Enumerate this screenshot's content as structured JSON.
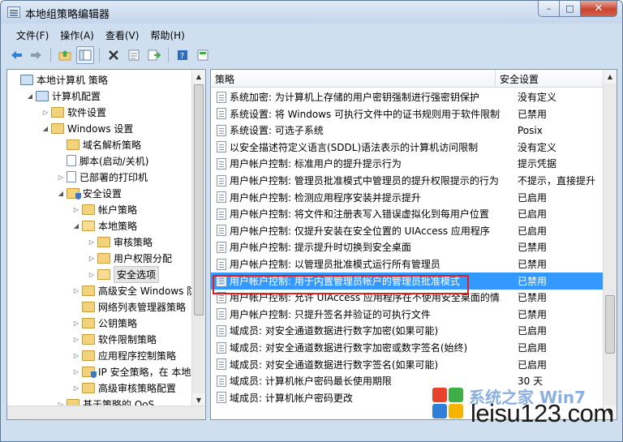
{
  "window": {
    "title": "本地组策略编辑器",
    "min": "–",
    "max": "□",
    "close": "✕"
  },
  "menu": [
    "文件(F)",
    "操作(A)",
    "查看(V)",
    "帮助(H)"
  ],
  "toolbar_icons": [
    "back-arrow-icon",
    "forward-arrow-icon",
    "up-folder-icon",
    "show-tree-icon",
    "delete-icon",
    "properties-icon",
    "export-icon",
    "help-icon",
    "filter-icon"
  ],
  "tree": [
    {
      "label": "本地计算机 策略",
      "indent": 0,
      "arrow": "",
      "icon": "comp"
    },
    {
      "label": "计算机配置",
      "indent": 1,
      "arrow": "◢",
      "icon": "comp"
    },
    {
      "label": "软件设置",
      "indent": 2,
      "arrow": "▷",
      "icon": "folder"
    },
    {
      "label": "Windows 设置",
      "indent": 2,
      "arrow": "◢",
      "icon": "folder"
    },
    {
      "label": "域名解析策略",
      "indent": 3,
      "arrow": "",
      "icon": "folder"
    },
    {
      "label": "脚本(启动/关机)",
      "indent": 3,
      "arrow": "",
      "icon": "doc"
    },
    {
      "label": "已部署的打印机",
      "indent": 3,
      "arrow": "▷",
      "icon": "doc"
    },
    {
      "label": "安全设置",
      "indent": 3,
      "arrow": "◢",
      "icon": "shield"
    },
    {
      "label": "帐户策略",
      "indent": 4,
      "arrow": "▷",
      "icon": "folder"
    },
    {
      "label": "本地策略",
      "indent": 4,
      "arrow": "◢",
      "icon": "open"
    },
    {
      "label": "审核策略",
      "indent": 5,
      "arrow": "▷",
      "icon": "folder"
    },
    {
      "label": "用户权限分配",
      "indent": 5,
      "arrow": "▷",
      "icon": "folder"
    },
    {
      "label": "安全选项",
      "indent": 5,
      "arrow": "▷",
      "icon": "open"
    },
    {
      "label": "高级安全 Windows 防火",
      "indent": 4,
      "arrow": "▷",
      "icon": "folder"
    },
    {
      "label": "网络列表管理器策略",
      "indent": 4,
      "arrow": "",
      "icon": "folder"
    },
    {
      "label": "公钥策略",
      "indent": 4,
      "arrow": "▷",
      "icon": "folder"
    },
    {
      "label": "软件限制策略",
      "indent": 4,
      "arrow": "▷",
      "icon": "folder"
    },
    {
      "label": "应用程序控制策略",
      "indent": 4,
      "arrow": "▷",
      "icon": "folder"
    },
    {
      "label": "IP 安全策略，在 本地计",
      "indent": 4,
      "arrow": "▷",
      "icon": "shield"
    },
    {
      "label": "高级审核策略配置",
      "indent": 4,
      "arrow": "▷",
      "icon": "folder"
    },
    {
      "label": "基于策略的 QoS",
      "indent": 3,
      "arrow": "▷",
      "icon": "folder"
    }
  ],
  "table": {
    "headers": [
      "策略",
      "安全设置"
    ],
    "rows": [
      {
        "policy": "系统加密: 为计算机上存储的用户密钥强制进行强密钥保护",
        "setting": "没有定义"
      },
      {
        "policy": "系统设置: 将 Windows 可执行文件中的证书规则用于软件限制策略",
        "setting": "已禁用"
      },
      {
        "policy": "系统设置: 可选子系统",
        "setting": "Posix"
      },
      {
        "policy": "以安全描述符定义语言(SDDL)语法表示的计算机访问限制",
        "setting": "没有定义"
      },
      {
        "policy": "用户帐户控制: 标准用户的提升提示行为",
        "setting": "提示凭据"
      },
      {
        "policy": "用户帐户控制: 管理员批准模式中管理员的提升权限提示的行为",
        "setting": "不提示，直接提升"
      },
      {
        "policy": "用户帐户控制: 检测应用程序安装并提示提升",
        "setting": "已启用"
      },
      {
        "policy": "用户帐户控制: 将文件和注册表写入错误虚拟化到每用户位置",
        "setting": "已启用"
      },
      {
        "policy": "用户帐户控制: 仅提升安装在安全位置的 UIAccess 应用程序",
        "setting": "已启用"
      },
      {
        "policy": "用户帐户控制: 提示提升时切换到安全桌面",
        "setting": "已禁用"
      },
      {
        "policy": "用户帐户控制: 以管理员批准模式运行所有管理员",
        "setting": "已禁用"
      },
      {
        "policy": "用户帐户控制: 用于内置管理员帐户的管理员批准模式",
        "setting": "已禁用",
        "selected": true
      },
      {
        "policy": "用户帐户控制: 允许 UIAccess 应用程序在不使用安全桌面的情况下提升",
        "setting": "已禁用"
      },
      {
        "policy": "用户帐户控制: 只提升签名并验证的可执行文件",
        "setting": "已禁用"
      },
      {
        "policy": "域成员: 对安全通道数据进行数字加密(如果可能)",
        "setting": "已启用"
      },
      {
        "policy": "域成员: 对安全通道数据进行数字加密或数字签名(始终)",
        "setting": "已启用"
      },
      {
        "policy": "域成员: 对安全通道数据进行数字签名(如果可能)",
        "setting": "已启用"
      },
      {
        "policy": "域成员: 计算机帐户密码最长使用期限",
        "setting": "30 天"
      },
      {
        "policy": "域成员: 计算机帐户密码更改",
        "setting": ""
      }
    ]
  },
  "watermark": {
    "text": "leisu123.com",
    "faint": "系统之家 Win7",
    "colors": [
      "#e8412c",
      "#3fae49",
      "#2f7fd6",
      "#f5b400"
    ]
  }
}
